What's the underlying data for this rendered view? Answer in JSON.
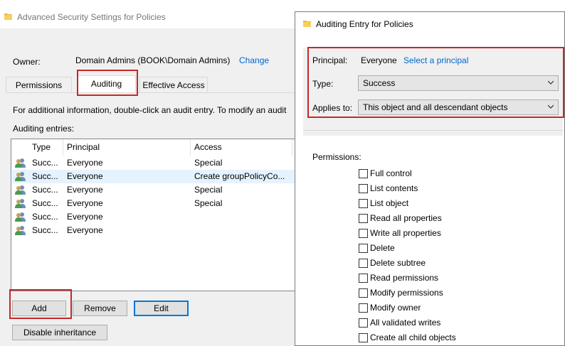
{
  "left_window": {
    "title": "Advanced Security Settings for Policies",
    "owner_label": "Owner:",
    "owner_value": "Domain Admins (BOOK\\Domain Admins)",
    "owner_change": "Change",
    "tabs": [
      {
        "label": "Permissions",
        "active": false
      },
      {
        "label": "Auditing",
        "active": true
      },
      {
        "label": "Effective Access",
        "active": false
      }
    ],
    "info_text": "For additional information, double-click an audit entry. To modify an audit",
    "entries_label": "Auditing entries:",
    "columns": [
      "Type",
      "Principal",
      "Access"
    ],
    "rows": [
      {
        "type": "Succ...",
        "principal": "Everyone",
        "access": "Special",
        "selected": false
      },
      {
        "type": "Succ...",
        "principal": "Everyone",
        "access": "Create groupPolicyCo...",
        "selected": true
      },
      {
        "type": "Succ...",
        "principal": "Everyone",
        "access": "Special",
        "selected": false
      },
      {
        "type": "Succ...",
        "principal": "Everyone",
        "access": "Special",
        "selected": false
      },
      {
        "type": "Succ...",
        "principal": "Everyone",
        "access": "",
        "selected": false
      },
      {
        "type": "Succ...",
        "principal": "Everyone",
        "access": "",
        "selected": false
      }
    ],
    "buttons": {
      "add": "Add",
      "remove": "Remove",
      "edit": "Edit",
      "disable_inheritance": "Disable inheritance"
    }
  },
  "right_dialog": {
    "title": "Auditing Entry for Policies",
    "principal_label": "Principal:",
    "principal_value": "Everyone",
    "select_principal": "Select a principal",
    "type_label": "Type:",
    "type_value": "Success",
    "applies_label": "Applies to:",
    "applies_value": "This object and all descendant objects",
    "permissions_label": "Permissions:",
    "permissions": [
      "Full control",
      "List contents",
      "List object",
      "Read all properties",
      "Write all properties",
      "Delete",
      "Delete subtree",
      "Read permissions",
      "Modify permissions",
      "Modify owner",
      "All validated writes",
      "Create all child objects"
    ]
  },
  "colors": {
    "highlight_red": "#c62828",
    "link_blue": "#0066cc",
    "selection": "#e5f3ff",
    "default_button_border": "#0078d7"
  }
}
